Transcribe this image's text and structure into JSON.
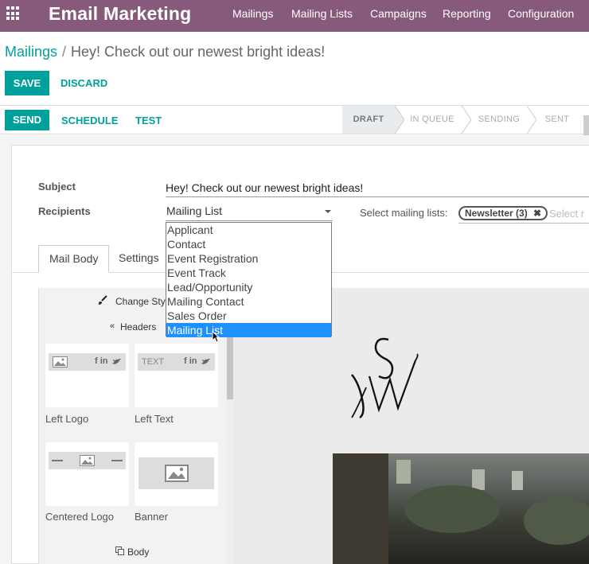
{
  "app": {
    "title": "Email Marketing",
    "menu": [
      "Mailings",
      "Mailing Lists",
      "Campaigns",
      "Reporting",
      "Configuration"
    ]
  },
  "breadcrumb": {
    "parent": "Mailings",
    "separator": "/",
    "current": "Hey! Check out our newest bright ideas!"
  },
  "buttons": {
    "save": "SAVE",
    "discard": "DISCARD",
    "send": "SEND",
    "schedule": "SCHEDULE",
    "test": "TEST"
  },
  "stages": [
    "DRAFT",
    "IN QUEUE",
    "SENDING",
    "SENT"
  ],
  "active_stage": "DRAFT",
  "form": {
    "subject_label": "Subject",
    "subject_value": "Hey! Check out our newest bright ideas!",
    "recipients_label": "Recipients",
    "recipients_value": "Mailing List",
    "select_lists_label": "Select mailing lists:",
    "tag_label": "Newsletter (3)",
    "select_placeholder": "Select r"
  },
  "dropdown_options": [
    "Applicant",
    "Contact",
    "Event Registration",
    "Event Track",
    "Lead/Opportunity",
    "Mailing Contact",
    "Sales Order",
    "Mailing List"
  ],
  "dropdown_selected": "Mailing List",
  "tabs": [
    "Mail Body",
    "Settings"
  ],
  "snippets": {
    "change_style": "Change Style",
    "headers": "Headers",
    "items": [
      "Left Logo",
      "Left Text",
      "Centered Logo",
      "Banner"
    ],
    "thumb_text": "TEXT",
    "social_text": "f in",
    "body": "Body"
  },
  "colors": {
    "topbar": "#875a7b",
    "accent": "#00a09d",
    "selected": "#1e90ff"
  }
}
